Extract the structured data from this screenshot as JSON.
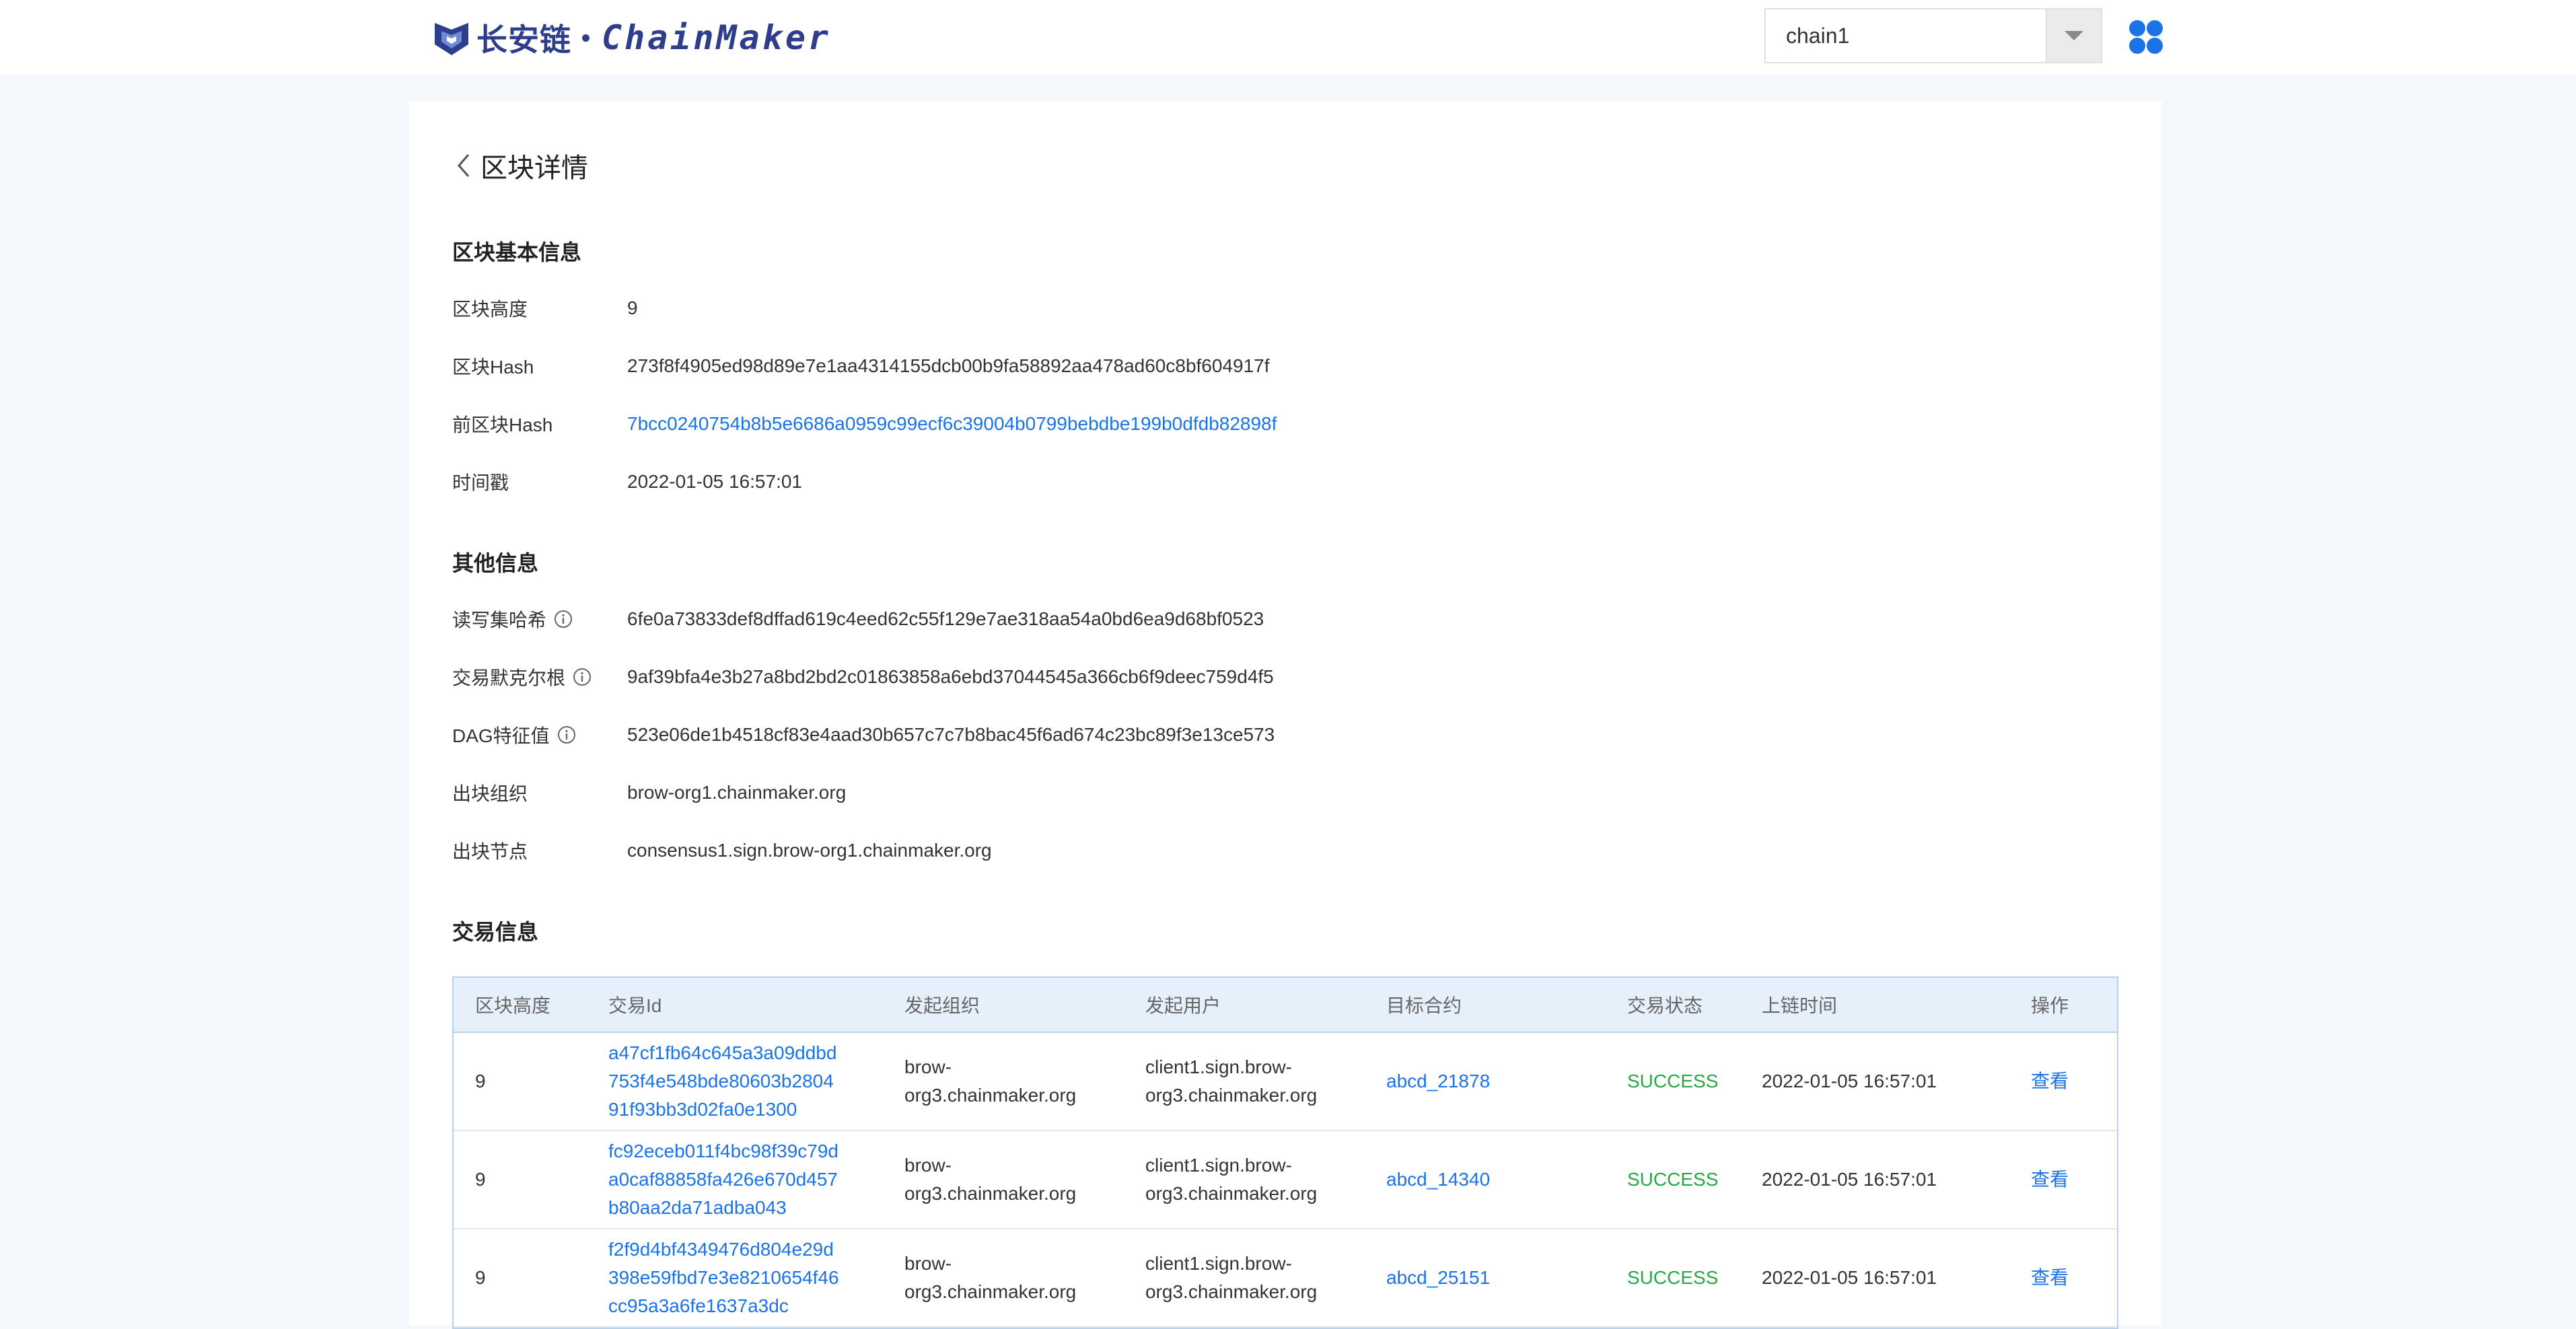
{
  "header": {
    "logo_cn": "长安链",
    "logo_en": "ChainMaker",
    "chain_select": {
      "value": "chain1"
    },
    "colors": {
      "brand": "#2e3e8c",
      "accent": "#1a73e8"
    },
    "icons": {
      "menu": "grid-menu-icon",
      "dropdown": "chevron-down-icon"
    }
  },
  "page": {
    "title": "区块详情",
    "back_icon": "chevron-left-icon"
  },
  "basic_info": {
    "title": "区块基本信息",
    "rows": [
      {
        "label": "区块高度",
        "value": "9"
      },
      {
        "label": "区块Hash",
        "value": "273f8f4905ed98d89e7e1aa4314155dcb00b9fa58892aa478ad60c8bf604917f"
      },
      {
        "label": "前区块Hash",
        "value": "7bcc0240754b8b5e6686a0959c99ecf6c39004b0799bebdbe199b0dfdb82898f"
      },
      {
        "label": "时间戳",
        "value": "2022-01-05 16:57:01"
      }
    ]
  },
  "other_info": {
    "title": "其他信息",
    "rows": [
      {
        "label": "读写集哈希",
        "value": "6fe0a73833def8dffad619c4eed62c55f129e7ae318aa54a0bd6ea9d68bf0523"
      },
      {
        "label": "交易默克尔根",
        "value": "9af39bfa4e3b27a8bd2bd2c01863858a6ebd37044545a366cb6f9deec759d4f5"
      },
      {
        "label": "DAG特征值",
        "value": "523e06de1b4518cf83e4aad30b657c7c7b8bac45f6ad674c23bc89f3e13ce573"
      },
      {
        "label": "出块组织",
        "value": "brow-org1.chainmaker.org"
      },
      {
        "label": "出块节点",
        "value": "consensus1.sign.brow-org1.chainmaker.org"
      }
    ]
  },
  "tx_info": {
    "title": "交易信息",
    "columns": [
      "区块高度",
      "交易Id",
      "发起组织",
      "发起用户",
      "目标合约",
      "交易状态",
      "上链时间",
      "操作"
    ],
    "rows": [
      {
        "height": "9",
        "tx_id": [
          "a47cf1fb64c645a3a09ddbd",
          "753f4e548bde80603b2804",
          "91f93bb3d02fa0e1300"
        ],
        "org": [
          "brow-",
          "org3.chainmaker.org"
        ],
        "user": [
          "client1.sign.brow-",
          "org3.chainmaker.org"
        ],
        "contract": "abcd_21878",
        "status": "SUCCESS",
        "time": "2022-01-05 16:57:01",
        "action": "查看"
      },
      {
        "height": "9",
        "tx_id": [
          "fc92eceb011f4bc98f39c79d",
          "a0caf88858fa426e670d457",
          "b80aa2da71adba043"
        ],
        "org": [
          "brow-",
          "org3.chainmaker.org"
        ],
        "user": [
          "client1.sign.brow-",
          "org3.chainmaker.org"
        ],
        "contract": "abcd_14340",
        "status": "SUCCESS",
        "time": "2022-01-05 16:57:01",
        "action": "查看"
      },
      {
        "height": "9",
        "tx_id": [
          "f2f9d4bf4349476d804e29d",
          "398e59fbd7e3e8210654f46",
          "cc95a3a6fe1637a3dc"
        ],
        "org": [
          "brow-",
          "org3.chainmaker.org"
        ],
        "user": [
          "client1.sign.brow-",
          "org3.chainmaker.org"
        ],
        "contract": "abcd_25151",
        "status": "SUCCESS",
        "time": "2022-01-05 16:57:01",
        "action": "查看"
      }
    ]
  }
}
